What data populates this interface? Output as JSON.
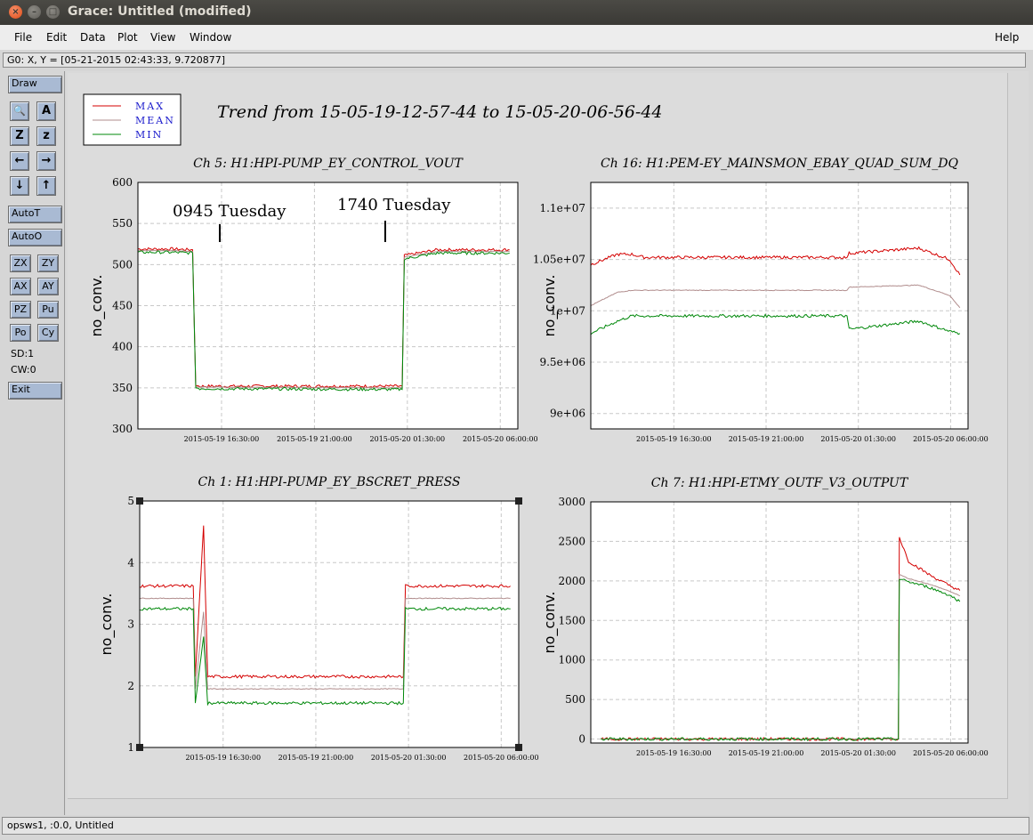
{
  "window": {
    "title": "Grace: Untitled (modified)",
    "close_glyph": "×",
    "minimize_glyph": "–",
    "maximize_glyph": "□"
  },
  "menu": {
    "file": "File",
    "edit": "Edit",
    "data": "Data",
    "plot": "Plot",
    "view": "View",
    "window": "Window",
    "help": "Help"
  },
  "status_top": "G0: X, Y = [05-21-2015 02:43:33, 9.720877]",
  "status_bottom": "opsws1, :0.0, Untitled",
  "toolbar": {
    "draw": "Draw",
    "autot": "AutoT",
    "autoo": "AutoO",
    "zx": "ZX",
    "zy": "ZY",
    "ax": "AX",
    "ay": "AY",
    "pz": "PZ",
    "pu": "Pu",
    "po": "Po",
    "cy": "Cy",
    "sd": "SD:1",
    "cw": "CW:0",
    "exit": "Exit",
    "icons": [
      "zoom-icon",
      "autoscale-text-icon",
      "zoom-in-icon",
      "zoom-out-icon",
      "arrow-left-icon",
      "arrow-right-icon",
      "arrow-down-icon",
      "arrow-up-icon"
    ],
    "icon_glyphs": {
      "zoom": "🔍",
      "as": "A",
      "zoomin": "Z",
      "zoomout": "z",
      "left": "←",
      "right": "→",
      "down": "↓",
      "up": "↑"
    }
  },
  "plot": {
    "title": "Trend from 15-05-19-12-57-44 to 15-05-20-06-56-44",
    "legend": [
      {
        "label": "MAX",
        "color": "#d40000"
      },
      {
        "label": "MEAN",
        "color": "#b08c8c"
      },
      {
        "label": "MIN",
        "color": "#00880a"
      }
    ],
    "label_color": "#1a1acc",
    "annotations": [
      "0945 Tuesday",
      "1740 Tuesday"
    ]
  },
  "chart_data": [
    {
      "type": "line",
      "title": "Ch 5: H1:HPI-PUMP_EY_CONTROL_VOUT",
      "ylabel": "no_conv.",
      "ylim": [
        300,
        600
      ],
      "yticks": [
        "300",
        "350",
        "400",
        "450",
        "500",
        "550",
        "600"
      ],
      "xticks": [
        "2015-05-19 16:30:00",
        "2015-05-19 21:00:00",
        "2015-05-20 01:30:00",
        "2015-05-20 06:00:00"
      ],
      "x_hours": [
        0,
        1.6,
        2.65,
        2.8,
        3.0,
        3.5,
        12.8,
        12.9,
        14.5,
        18.0
      ],
      "series": [
        {
          "name": "MAX",
          "values": [
            519,
            519,
            518,
            353,
            352,
            352,
            352,
            511,
            518,
            518
          ]
        },
        {
          "name": "MEAN",
          "values": [
            517,
            517,
            516,
            351,
            351,
            351,
            350,
            509,
            516,
            516
          ]
        },
        {
          "name": "MIN",
          "values": [
            515,
            515,
            514,
            350,
            349,
            349,
            348,
            507,
            514,
            514
          ]
        }
      ]
    },
    {
      "type": "line",
      "title": "Ch 16: H1:PEM-EY_MAINSMON_EBAY_QUAD_SUM_DQ",
      "ylabel": "no_conv.",
      "ylim": [
        8850000,
        11250000
      ],
      "yticks": [
        "9e+06",
        "9.5e+06",
        "1e+07",
        "1.05e+07",
        "1.1e+07"
      ],
      "xticks": [
        "2015-05-19 16:30:00",
        "2015-05-19 21:00:00",
        "2015-05-20 01:30:00",
        "2015-05-20 06:00:00"
      ],
      "x_hours": [
        0,
        1.3,
        2.0,
        2.6,
        12.5,
        12.6,
        16.0,
        17.5,
        18.0
      ],
      "series": [
        {
          "name": "MAX",
          "values": [
            10450000,
            10550000,
            10550000,
            10520000,
            10520000,
            10560000,
            10610000,
            10500000,
            10350000
          ]
        },
        {
          "name": "MEAN",
          "values": [
            10050000,
            10180000,
            10200000,
            10200000,
            10200000,
            10230000,
            10250000,
            10150000,
            10030000
          ]
        },
        {
          "name": "MIN",
          "values": [
            9780000,
            9900000,
            9950000,
            9950000,
            9950000,
            9820000,
            9900000,
            9800000,
            9780000
          ]
        }
      ]
    },
    {
      "type": "line",
      "title": "Ch 1: H1:HPI-PUMP_EY_BSCRET_PRESS",
      "ylabel": "no_conv.",
      "ylim": [
        1,
        5
      ],
      "yticks": [
        "1",
        "2",
        "3",
        "4",
        "5"
      ],
      "xticks": [
        "2015-05-19 16:30:00",
        "2015-05-19 21:00:00",
        "2015-05-20 01:30:00",
        "2015-05-20 06:00:00"
      ],
      "x_hours": [
        0,
        2.6,
        2.7,
        3.1,
        3.3,
        12.8,
        12.9,
        18.0
      ],
      "series": [
        {
          "name": "MAX",
          "values": [
            3.62,
            3.62,
            2.15,
            4.6,
            2.15,
            2.15,
            3.62,
            3.62
          ]
        },
        {
          "name": "MEAN",
          "values": [
            3.42,
            3.42,
            1.95,
            3.2,
            1.95,
            1.95,
            3.42,
            3.42
          ]
        },
        {
          "name": "MIN",
          "values": [
            3.25,
            3.25,
            1.72,
            2.8,
            1.72,
            1.72,
            3.25,
            3.25
          ]
        }
      ]
    },
    {
      "type": "line",
      "title": "Ch 7: H1:HPI-ETMY_OUTF_V3_OUTPUT",
      "ylabel": "no_conv.",
      "ylim": [
        -50,
        3000
      ],
      "yticks": [
        "0",
        "500",
        "1000",
        "1500",
        "2000",
        "2500",
        "3000"
      ],
      "xticks": [
        "2015-05-19 16:30:00",
        "2015-05-19 21:00:00",
        "2015-05-20 01:30:00",
        "2015-05-20 06:00:00"
      ],
      "x_hours": [
        0.5,
        15.0,
        15.05,
        15.5,
        16.5,
        17.5,
        18.0
      ],
      "series": [
        {
          "name": "MAX",
          "values": [
            0,
            0,
            2550,
            2250,
            2080,
            1940,
            1880
          ]
        },
        {
          "name": "MEAN",
          "values": [
            0,
            0,
            2080,
            2030,
            1960,
            1870,
            1810
          ]
        },
        {
          "name": "MIN",
          "values": [
            0,
            0,
            2020,
            1990,
            1920,
            1820,
            1740
          ]
        }
      ]
    }
  ]
}
